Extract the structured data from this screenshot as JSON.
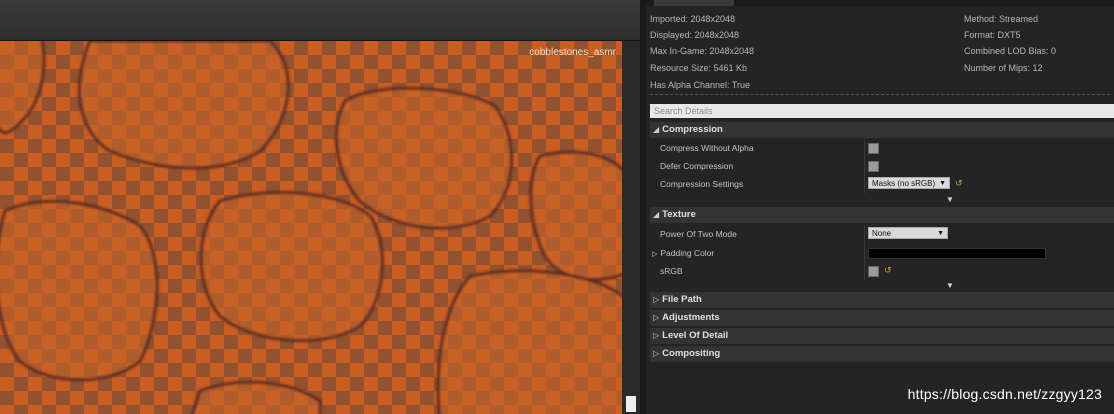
{
  "viewport": {
    "texture_name": "cobblestones_asmr"
  },
  "details": {
    "info": {
      "imported": "Imported: 2048x2048",
      "displayed": "Displayed: 2048x2048",
      "max_in_game": "Max In-Game: 2048x2048",
      "resource_size": "Resource Size: 5461 Kb",
      "has_alpha": "Has Alpha Channel: True",
      "method": "Method: Streamed",
      "format": "Format: DXT5",
      "combined_lod_bias": "Combined LOD Bias: 0",
      "num_mips": "Number of Mips: 12"
    },
    "search_placeholder": "Search Details",
    "compression": {
      "title": "Compression",
      "compress_without_alpha": "Compress Without Alpha",
      "defer_compression": "Defer Compression",
      "compression_settings": "Compression Settings",
      "compression_settings_value": "Masks (no sRGB)"
    },
    "texture": {
      "title": "Texture",
      "power_of_two_mode": "Power Of Two Mode",
      "power_of_two_value": "None",
      "padding_color": "Padding Color",
      "srgb": "sRGB"
    },
    "categories": {
      "file_path": "File Path",
      "adjustments": "Adjustments",
      "level_of_detail": "Level Of Detail",
      "compositing": "Compositing"
    }
  },
  "watermark": "https://blog.csdn.net/zzgyy123",
  "colors": {
    "texture_orange": "#c95d22",
    "panel_bg": "#242424",
    "reset_arrow": "#d4a23a"
  },
  "icons": {
    "expand_arrow": "▲",
    "collapsed_arrow": "▷",
    "dropdown_caret": "▼",
    "reset": "↺"
  }
}
